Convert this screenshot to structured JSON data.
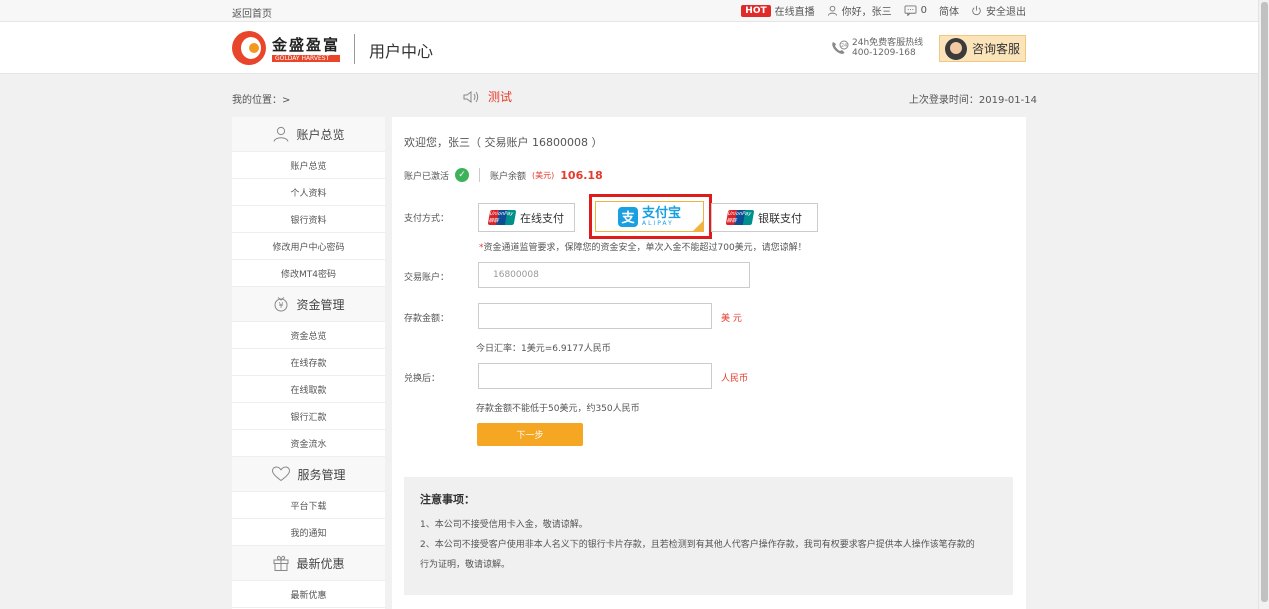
{
  "topbar": {
    "home_link": "返回首页",
    "hot_badge": "HOT",
    "live_label": "在线直播",
    "greeting": "你好，张三",
    "messages_count": "0",
    "language": "简体",
    "logout": "安全退出"
  },
  "header": {
    "logo_cn": "金盛盈富",
    "logo_en": "GOLDAY HARVEST",
    "title": "用户中心",
    "hotline_label": "24h免费客服热线",
    "hotline_number": "400-1209-168",
    "consult_label": "咨询客服"
  },
  "bar": {
    "breadcrumb": "我的位置：>",
    "notice": "测试",
    "last_login": "上次登录时间：2019-01-14"
  },
  "sidebar": {
    "groups": [
      {
        "title": "账户总览",
        "icon": "user-icon",
        "items": [
          "账户总览",
          "个人资料",
          "银行资料",
          "修改用户中心密码",
          "修改MT4密码"
        ]
      },
      {
        "title": "资金管理",
        "icon": "money-icon",
        "items": [
          "资金总览",
          "在线存款",
          "在线取款",
          "银行汇款",
          "资金流水"
        ]
      },
      {
        "title": "服务管理",
        "icon": "heart-icon",
        "items": [
          "平台下载",
          "我的通知"
        ]
      },
      {
        "title": "最新优惠",
        "icon": "gift-icon",
        "items": [
          "最新优惠"
        ]
      }
    ]
  },
  "main": {
    "welcome": "欢迎您，张三（ 交易账户 16800008 ）",
    "activated": "账户已激活",
    "balance_label": "账户余额",
    "balance_unit": "(美元)",
    "balance_value": "106.18",
    "pay_label": "支付方式：",
    "pay_methods": {
      "online": "在线支付",
      "alipay_cn": "支付宝",
      "alipay_en": "ALIPAY",
      "unionpay": "银联支付"
    },
    "unionpay_logo": "UnionPay 银联",
    "warning": "资金通道监管要求，保障您的资金安全，单次入金不能超过700美元，请您谅解！",
    "account_label": "交易账户：",
    "account_value": "16800008",
    "amount_label": "存款金额：",
    "amount_unit": "美 元",
    "rate_text": "今日汇率：1美元=6.9177人民币",
    "converted_label": "兑换后：",
    "converted_unit": "人民币",
    "min_text": "存款金额不能低于50美元，约350人民币",
    "next_button": "下一步"
  },
  "notes": {
    "title": "注意事项：",
    "line1": "1、本公司不接受信用卡入金，敬请谅解。",
    "line2": "2、本公司不接受客户使用非本人名义下的银行卡片存款，且若检测到有其他人代客户操作存款，我司有权要求客户提供本人操作该笔存款的",
    "line3": "行为证明，敬请谅解。"
  },
  "colors": {
    "accent_red": "#e53b2c",
    "button_orange": "#f5a623",
    "alipay_blue": "#1a9fe0",
    "highlight_red": "#e01b1b"
  }
}
